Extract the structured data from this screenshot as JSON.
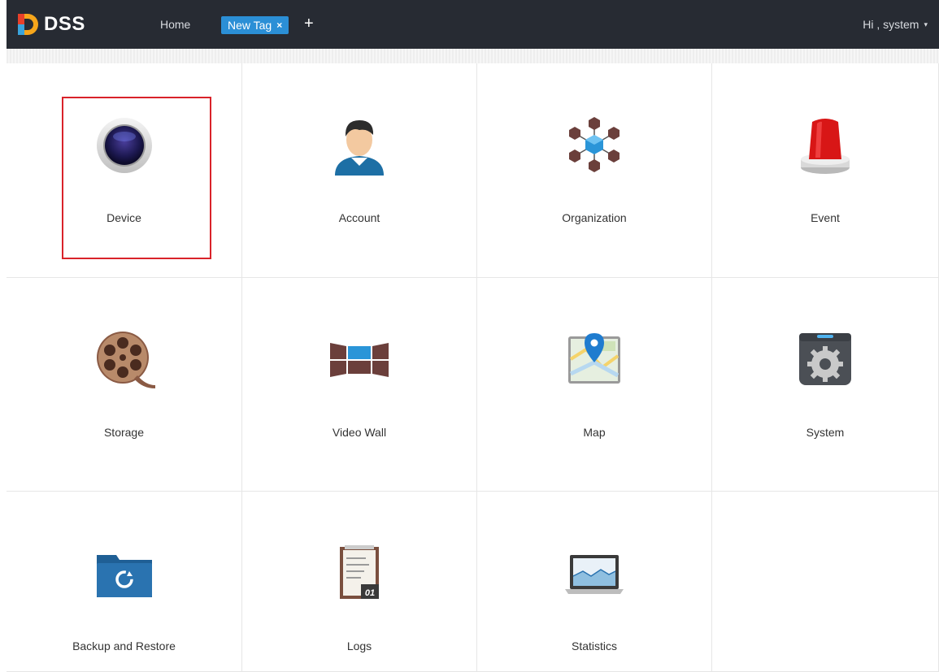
{
  "header": {
    "app_name": "DSS",
    "home_label": "Home",
    "tab_label": "New Tag",
    "tab_close": "×",
    "add_tab": "+",
    "user_greeting": "Hi , system",
    "user_caret": "▾"
  },
  "tiles": [
    {
      "label": "Device",
      "icon": "camera-lens-icon",
      "selected": true
    },
    {
      "label": "Account",
      "icon": "user-icon"
    },
    {
      "label": "Organization",
      "icon": "network-cubes-icon"
    },
    {
      "label": "Event",
      "icon": "alarm-light-icon"
    },
    {
      "label": "Storage",
      "icon": "film-reel-icon"
    },
    {
      "label": "Video Wall",
      "icon": "video-wall-icon"
    },
    {
      "label": "Map",
      "icon": "map-pin-icon"
    },
    {
      "label": "System",
      "icon": "gear-icon"
    },
    {
      "label": "Backup and Restore",
      "icon": "folder-restore-icon"
    },
    {
      "label": "Logs",
      "icon": "log-notepad-icon"
    },
    {
      "label": "Statistics",
      "icon": "laptop-chart-icon"
    }
  ],
  "colors": {
    "header_bg": "#272b33",
    "tab_accent": "#2b8fd6",
    "selection_border": "#d9232a"
  }
}
